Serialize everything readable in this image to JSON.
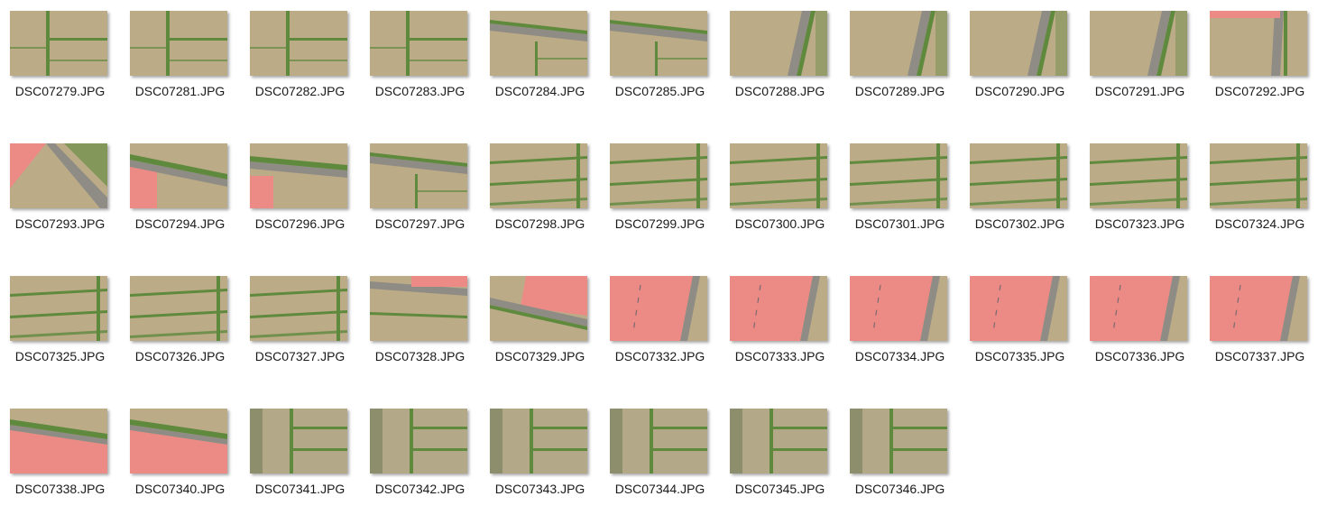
{
  "files": [
    {
      "name": "DSC07279.JPG",
      "scene": "field-cross"
    },
    {
      "name": "DSC07281.JPG",
      "scene": "field-cross"
    },
    {
      "name": "DSC07282.JPG",
      "scene": "field-cross"
    },
    {
      "name": "DSC07283.JPG",
      "scene": "field-cross"
    },
    {
      "name": "DSC07284.JPG",
      "scene": "road-diag"
    },
    {
      "name": "DSC07285.JPG",
      "scene": "road-diag"
    },
    {
      "name": "DSC07288.JPG",
      "scene": "road-vert"
    },
    {
      "name": "DSC07289.JPG",
      "scene": "road-vert"
    },
    {
      "name": "DSC07290.JPG",
      "scene": "road-vert"
    },
    {
      "name": "DSC07291.JPG",
      "scene": "road-vert"
    },
    {
      "name": "DSC07292.JPG",
      "scene": "road-vert-roof"
    },
    {
      "name": "DSC07293.JPG",
      "scene": "roof-corner"
    },
    {
      "name": "DSC07294.JPG",
      "scene": "roof-left"
    },
    {
      "name": "DSC07296.JPG",
      "scene": "roof-left-road"
    },
    {
      "name": "DSC07297.JPG",
      "scene": "road-diag"
    },
    {
      "name": "DSC07298.JPG",
      "scene": "field-rows"
    },
    {
      "name": "DSC07299.JPG",
      "scene": "field-rows"
    },
    {
      "name": "DSC07300.JPG",
      "scene": "field-rows"
    },
    {
      "name": "DSC07301.JPG",
      "scene": "field-rows"
    },
    {
      "name": "DSC07302.JPG",
      "scene": "field-rows"
    },
    {
      "name": "DSC07323.JPG",
      "scene": "field-rows"
    },
    {
      "name": "DSC07324.JPG",
      "scene": "field-rows"
    },
    {
      "name": "DSC07325.JPG",
      "scene": "field-rows"
    },
    {
      "name": "DSC07326.JPG",
      "scene": "field-rows"
    },
    {
      "name": "DSC07327.JPG",
      "scene": "field-rows"
    },
    {
      "name": "DSC07328.JPG",
      "scene": "road-roof-top"
    },
    {
      "name": "DSC07329.JPG",
      "scene": "roof-right"
    },
    {
      "name": "DSC07332.JPG",
      "scene": "roof-big"
    },
    {
      "name": "DSC07333.JPG",
      "scene": "roof-big"
    },
    {
      "name": "DSC07334.JPG",
      "scene": "roof-big"
    },
    {
      "name": "DSC07335.JPG",
      "scene": "roof-big"
    },
    {
      "name": "DSC07336.JPG",
      "scene": "roof-big"
    },
    {
      "name": "DSC07337.JPG",
      "scene": "roof-big"
    },
    {
      "name": "DSC07338.JPG",
      "scene": "roof-bottom"
    },
    {
      "name": "DSC07340.JPG",
      "scene": "roof-bottom"
    },
    {
      "name": "DSC07341.JPG",
      "scene": "field-green"
    },
    {
      "name": "DSC07342.JPG",
      "scene": "field-green"
    },
    {
      "name": "DSC07343.JPG",
      "scene": "field-green"
    },
    {
      "name": "DSC07344.JPG",
      "scene": "field-green"
    },
    {
      "name": "DSC07345.JPG",
      "scene": "field-green"
    },
    {
      "name": "DSC07346.JPG",
      "scene": "field-green"
    }
  ],
  "colors": {
    "field": "#b5a47f",
    "field_light": "#c9bb98",
    "strip": "#5f8a3e",
    "road": "#8e8c85",
    "roof": "#ec8a85"
  }
}
